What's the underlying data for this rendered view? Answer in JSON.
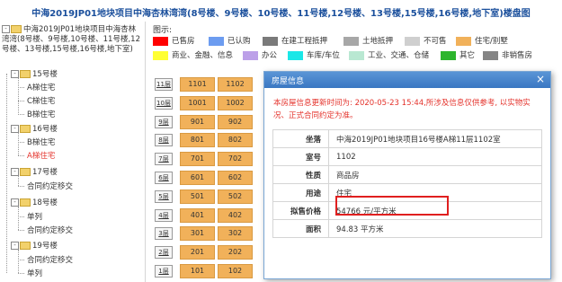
{
  "page_title": "中海2019JP01地块项目中海杏林湾湾(8号楼、9号楼、10号楼、11号楼,12号楼、13号楼,15号楼,16号楼,地下室)楼盘图",
  "tree": {
    "root": "中海2019JP01地块项目中海杏林湾湾(8号楼、9号楼,10号楼、11号楼,12号楼、13号楼,15号楼,16号楼,地下室)",
    "nodes": [
      {
        "label": "15号楼",
        "children": [
          "A梯住宅",
          "C梯住宅",
          "B梯住宅"
        ]
      },
      {
        "label": "16号楼",
        "children": [
          "B梯住宅",
          "A梯住宅"
        ]
      },
      {
        "label": "17号楼",
        "children": [
          "合同约定移交"
        ]
      },
      {
        "label": "18号楼",
        "children": [
          "单列",
          "合同约定移交"
        ]
      },
      {
        "label": "19号楼",
        "children": [
          "合同约定移交",
          "单列"
        ]
      }
    ]
  },
  "legend": {
    "title": "图示:",
    "items": [
      {
        "label": "已售房",
        "color": "#ff0000"
      },
      {
        "label": "已认购",
        "color": "#6c9cf0"
      },
      {
        "label": "在建工程抵押",
        "color": "#7a7a7a"
      },
      {
        "label": "土地抵押",
        "color": "#a7a7a7"
      },
      {
        "label": "不可售",
        "color": "#cfcfcf"
      },
      {
        "label": "住宅/别墅",
        "color": "#f1b15a"
      },
      {
        "label": "商业、金融、信息",
        "color": "#ffff33"
      },
      {
        "label": "办公",
        "color": "#bca0e8"
      },
      {
        "label": "车库/车位",
        "color": "#1be7e7"
      },
      {
        "label": "工业、交通、仓储",
        "color": "#b9e8d2"
      },
      {
        "label": "其它",
        "color": "#2db52d"
      },
      {
        "label": "非销售房",
        "color": "#858585"
      }
    ]
  },
  "floors": [
    {
      "label": "11层",
      "units": [
        "1101",
        "1102"
      ]
    },
    {
      "label": "10层",
      "units": [
        "1001",
        "1002"
      ]
    },
    {
      "label": "9层",
      "units": [
        "901",
        "902"
      ]
    },
    {
      "label": "8层",
      "units": [
        "801",
        "802"
      ]
    },
    {
      "label": "7层",
      "units": [
        "701",
        "702"
      ]
    },
    {
      "label": "6层",
      "units": [
        "601",
        "602"
      ]
    },
    {
      "label": "5层",
      "units": [
        "501",
        "502"
      ]
    },
    {
      "label": "4层",
      "units": [
        "401",
        "402"
      ]
    },
    {
      "label": "3层",
      "units": [
        "301",
        "302"
      ]
    },
    {
      "label": "2层",
      "units": [
        "201",
        "202"
      ]
    },
    {
      "label": "1层",
      "units": [
        "101",
        "102"
      ]
    }
  ],
  "dialog": {
    "title": "房屋信息",
    "close_icon": "×",
    "notice": "本房屋信息更新时间为: 2020-05-23 15:44,所涉及信息仅供参考, 以实物实况、正式合同约定为准。",
    "rows": [
      {
        "key": "坐落",
        "value": "中海2019JP01地块项目16号楼A梯11层1102室"
      },
      {
        "key": "室号",
        "value": "1102"
      },
      {
        "key": "性质",
        "value": "商品房"
      },
      {
        "key": "用途",
        "value": "住宅"
      },
      {
        "key": "拟售价格",
        "value": "54766 元/平方米"
      },
      {
        "key": "面积",
        "value": "94.83 平方米"
      }
    ]
  }
}
